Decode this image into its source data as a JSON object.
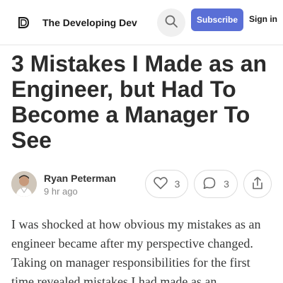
{
  "header": {
    "publication_name": "The Developing Dev",
    "subscribe_label": "Subscribe",
    "signin_label": "Sign in",
    "icons": {
      "logo": "publication-logo-icon",
      "search": "search-icon"
    },
    "accent_color": "#5a6fd6"
  },
  "post": {
    "title": "3 Mistakes I Made as an Engineer, but Had To Become a Manager To See",
    "author": "Ryan Peterman",
    "timestamp": "9 hr ago",
    "likes": "3",
    "comments": "3",
    "body": "I was shocked at how obvious my mistakes as an engineer became after my perspective changed. Taking on manager responsibilities for the first time revealed mistakes I had made as an"
  }
}
